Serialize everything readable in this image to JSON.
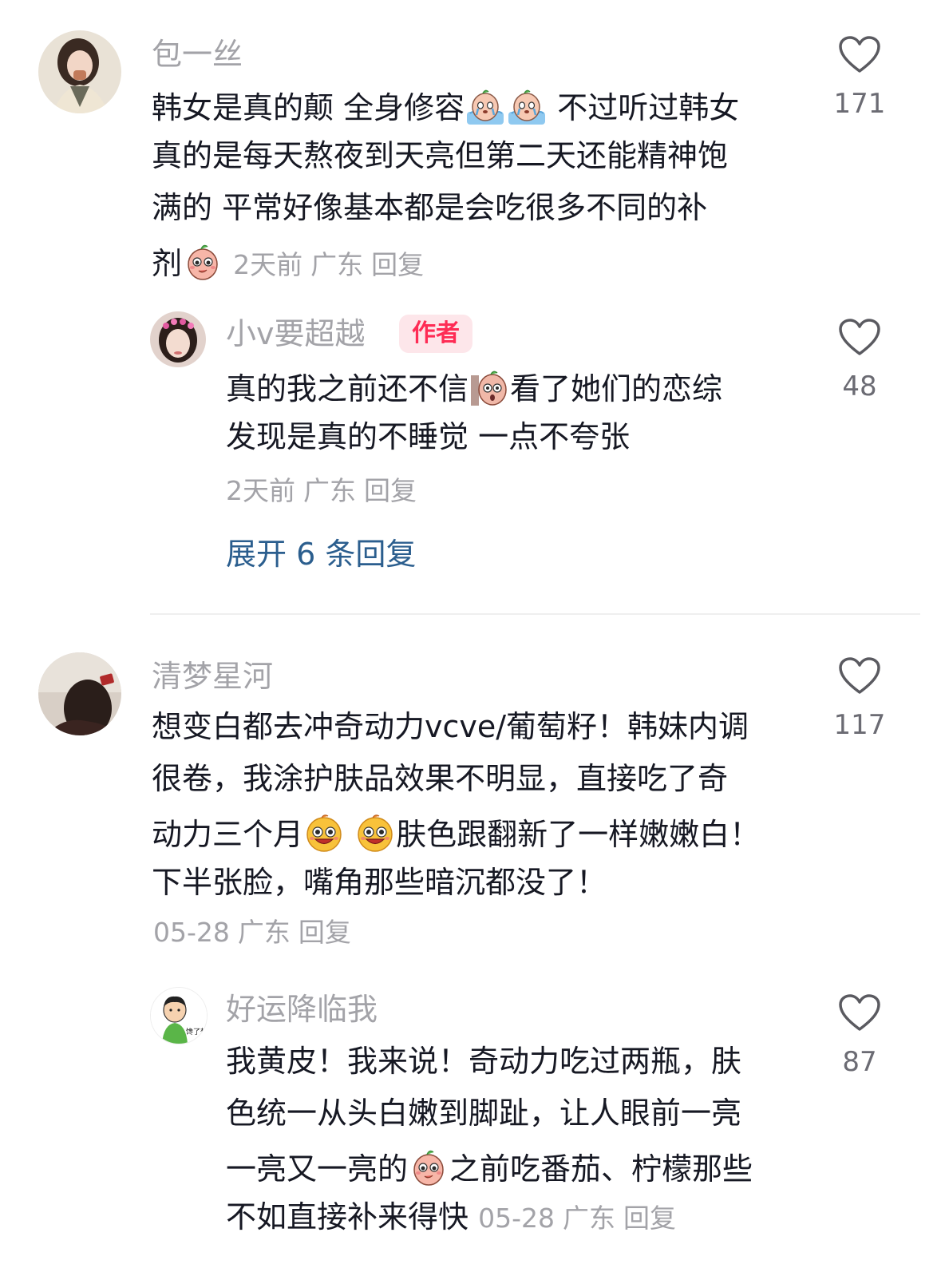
{
  "comments": [
    {
      "user": "包一丝",
      "lines": [
        "韩女是真的颠 全身修容",
        "不过听过韩女",
        "真的是每天熬夜到天亮但第二天还能精神饱",
        "满的 平常好像基本都是会吃很多不同的补",
        "剂"
      ],
      "time": "2天前",
      "location": "广东",
      "reply": "回复",
      "likes": "171",
      "emoji_names": [
        "crying-bean-emoji",
        "crying-bean-emoji",
        "cute-bean-emoji"
      ],
      "replies": [
        {
          "user": "小v要超越",
          "badge": "作者",
          "lines": [
            "真的我之前还不信",
            "看了她们的恋综",
            "发现是真的不睡觉 一点不夸张"
          ],
          "time": "2天前",
          "location": "广东",
          "reply": "回复",
          "likes": "48",
          "emoji_names": [
            "shocked-bean-emoji"
          ]
        }
      ],
      "expand": "展开 6 条回复"
    },
    {
      "user": "清梦星河",
      "lines": [
        "想变白都去冲奇动力vcve/葡萄籽！韩妹内调",
        "很卷，我涂护肤品效果不明显，直接吃了奇",
        "动力三个月",
        "肤色跟翻新了一样嫩嫩白！",
        "下半张脸，嘴角那些暗沉都没了！"
      ],
      "time": "05-28",
      "location": "广东",
      "reply": "回复",
      "likes": "117",
      "emoji_names": [
        "grin-face-emoji",
        "grin-face-emoji"
      ],
      "replies": [
        {
          "user": "好运降临我",
          "avatar_caption": "馋了想",
          "lines": [
            "我黄皮！我来说！奇动力吃过两瓶，肤",
            "色统一从头白嫩到脚趾，让人眼前一亮",
            "一亮又一亮的",
            "之前吃番茄、柠檬那些",
            "不如直接补来得快"
          ],
          "time": "05-28",
          "location": "广东",
          "reply": "回复",
          "likes": "87",
          "emoji_names": [
            "cute-bean-emoji"
          ]
        }
      ]
    }
  ],
  "colors": {
    "text": "#161823",
    "meta": "#a3a3a8",
    "link": "#2b5e8e",
    "badge_bg": "#fde6ea",
    "badge_text": "#fe2c55"
  }
}
